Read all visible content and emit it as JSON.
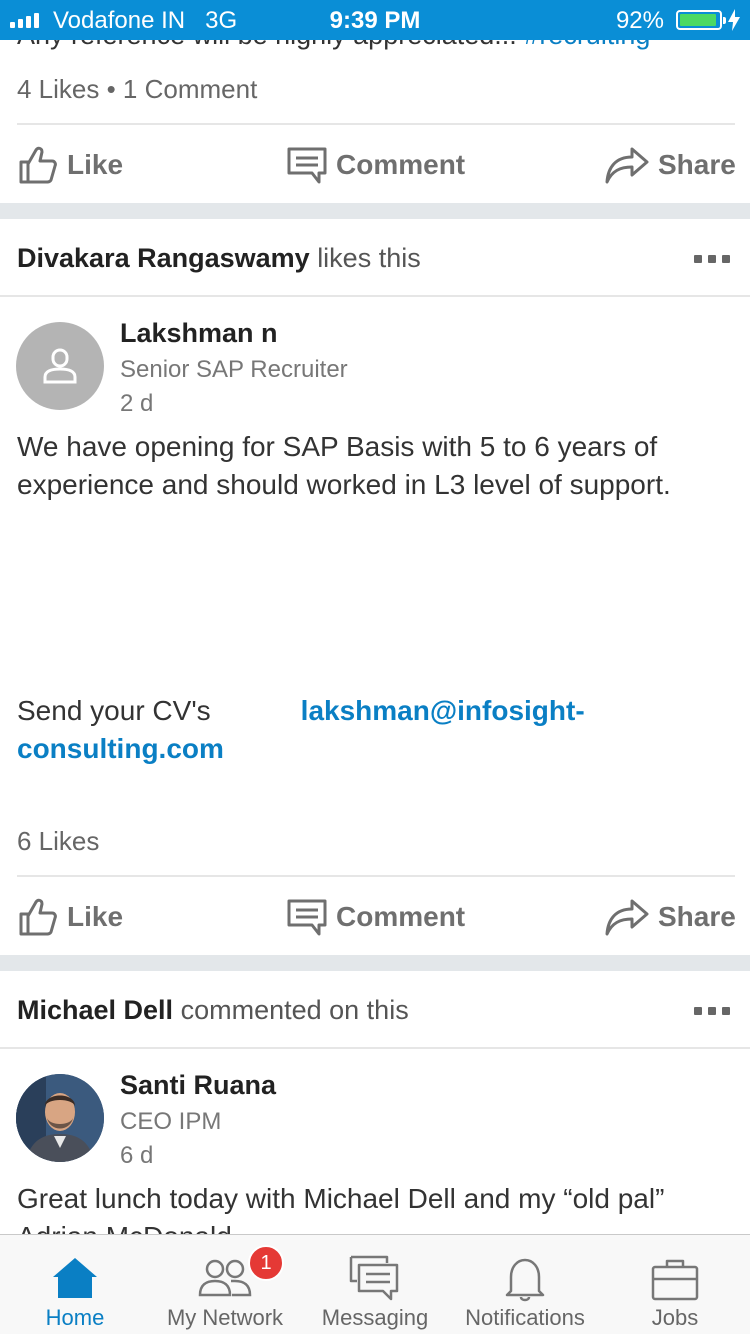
{
  "status_bar": {
    "carrier": "Vodafone IN",
    "network": "3G",
    "time": "9:39 PM",
    "battery": "92%",
    "battery_level": 0.92
  },
  "post1": {
    "cut_text": "Any reference will be highly appreciated...",
    "cut_hashtag": "#recruiting",
    "stats": "4 Likes • 1 Comment"
  },
  "actions": {
    "like": "Like",
    "comment": "Comment",
    "share": "Share"
  },
  "post2": {
    "actor": "Divakara Rangaswamy",
    "activity": "likes this",
    "author": "Lakshman n",
    "headline": "Senior SAP Recruiter",
    "age": "2 d",
    "body": "We have opening for SAP Basis with 5 to 6 years of experience and should worked in L3 level of support.",
    "cv_text": "Send your CV's",
    "email_part1": "lakshman@infosight-",
    "email_part2": "consulting.com",
    "stats": "6 Likes"
  },
  "post3": {
    "actor": "Michael Dell",
    "activity": "commented on this",
    "author": "Santi Ruana",
    "headline": "CEO IPM",
    "age": "6 d",
    "body_line1": "Great lunch today with Michael Dell and my “old pal”",
    "body_line2": "Adrian McDonald"
  },
  "tabs": [
    {
      "label": "Home",
      "icon": "home-icon",
      "active": true
    },
    {
      "label": "My Network",
      "icon": "network-icon",
      "badge": "1"
    },
    {
      "label": "Messaging",
      "icon": "messaging-icon"
    },
    {
      "label": "Notifications",
      "icon": "bell-icon"
    },
    {
      "label": "Jobs",
      "icon": "briefcase-icon"
    }
  ],
  "colors": {
    "brand": "#0a8ed6",
    "link": "#0a7fc4",
    "badge": "#e53935",
    "battery": "#4cd964"
  }
}
